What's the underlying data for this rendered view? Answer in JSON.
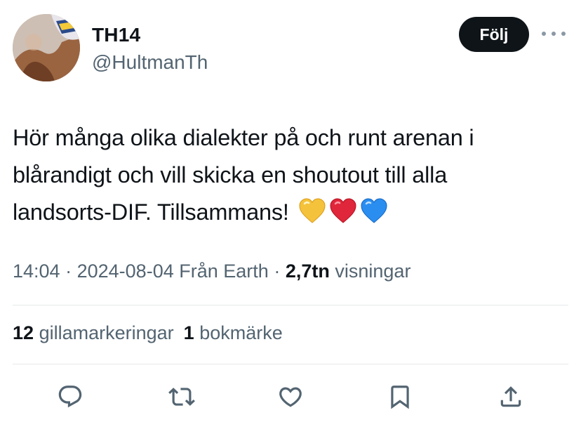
{
  "user": {
    "display_name": "TH14",
    "handle": "@HultmanTh",
    "avatar_icon": "profile-photo"
  },
  "follow_label": "Följ",
  "more_icon": "more-horizontal-icon",
  "tweet": {
    "lines": [
      "Hör många olika dialekter på och runt arenan i",
      "blårandigt och vill skicka en shoutout till alla",
      "landsorts-DIF. Tillsammans!"
    ],
    "emoji": [
      {
        "name": "yellow-heart",
        "color": "#f5c23b"
      },
      {
        "name": "red-heart",
        "color": "#e0263a"
      },
      {
        "name": "blue-heart",
        "color": "#2a8ef0"
      }
    ]
  },
  "meta": {
    "time": "14:04",
    "separator": "·",
    "date": "2024-08-04",
    "source": "Från Earth",
    "views_count": "2,7tn",
    "views_label": "visningar"
  },
  "stats": {
    "likes_count": "12",
    "likes_label": "gillamarkeringar",
    "bookmarks_count": "1",
    "bookmarks_label": "bokmärke"
  },
  "actions": [
    "reply-icon",
    "retweet-icon",
    "like-icon",
    "bookmark-icon",
    "share-icon"
  ],
  "colors": {
    "text": "#0f1419",
    "secondary": "#536471",
    "button_bg": "#0f1419",
    "divider": "#e6e8ea"
  }
}
